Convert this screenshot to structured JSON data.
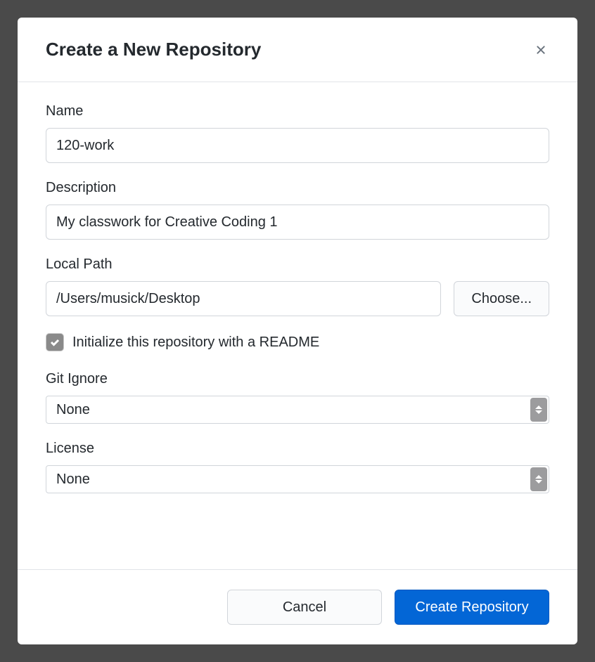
{
  "dialog": {
    "title": "Create a New Repository"
  },
  "fields": {
    "name": {
      "label": "Name",
      "value": "120-work"
    },
    "description": {
      "label": "Description",
      "value": "My classwork for Creative Coding 1"
    },
    "local_path": {
      "label": "Local Path",
      "value": "/Users/musick/Desktop",
      "choose_label": "Choose..."
    },
    "readme": {
      "label": "Initialize this repository with a README",
      "checked": true
    },
    "gitignore": {
      "label": "Git Ignore",
      "value": "None"
    },
    "license": {
      "label": "License",
      "value": "None"
    }
  },
  "footer": {
    "cancel_label": "Cancel",
    "create_label": "Create Repository"
  }
}
